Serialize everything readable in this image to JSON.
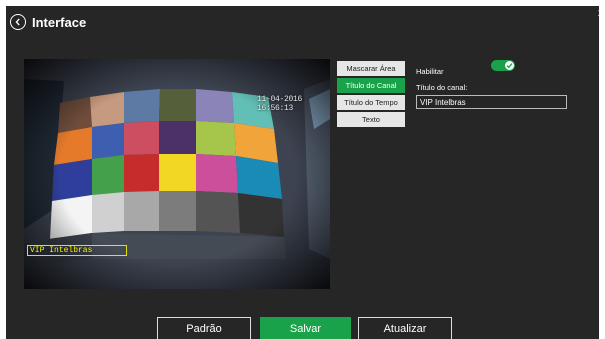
{
  "header": {
    "title": "Interface",
    "close_label": "x"
  },
  "video": {
    "time_overlay": "11-04-2016 16:56:13",
    "channel_overlay": "VIP Intelbras"
  },
  "menu": {
    "items": [
      "Mascarar Área",
      "Título do Canal",
      "Título do Tempo",
      "Texto"
    ],
    "active_index": 1
  },
  "settings": {
    "enable_label": "Habilitar",
    "enabled": true,
    "channel_title_label": "Título do canal:",
    "channel_title_value": "VIP Intelbras"
  },
  "footer": {
    "default_label": "Padrão",
    "save_label": "Salvar",
    "refresh_label": "Atualizar"
  },
  "colors": {
    "accent": "#19a24a",
    "background": "#262626",
    "overlay_box": "#e5e000"
  },
  "icons": {
    "back": "chevron-left-circle-icon",
    "toggle": "check-icon"
  }
}
